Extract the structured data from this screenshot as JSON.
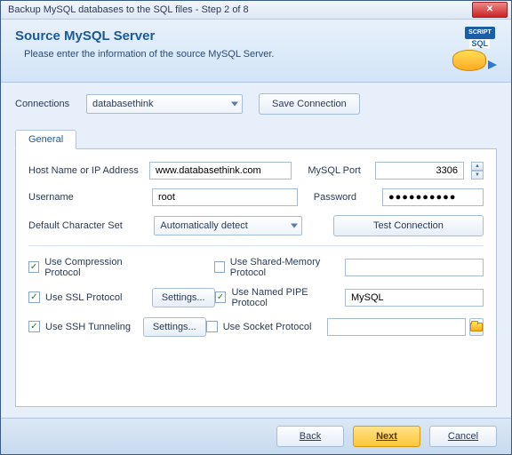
{
  "window": {
    "title": "Backup MySQL databases to the SQL files - Step 2 of 8"
  },
  "header": {
    "title": "Source MySQL Server",
    "subtitle": "Please enter the information of the source MySQL Server.",
    "script_tag": "SCRIPT",
    "sql_label": "SQL"
  },
  "connections": {
    "label": "Connections",
    "selected": "databasethink",
    "save_btn": "Save Connection"
  },
  "tab": {
    "general": "General"
  },
  "form": {
    "host_label": "Host Name or IP Address",
    "host_value": "www.databasethink.com",
    "port_label": "MySQL Port",
    "port_value": "3306",
    "user_label": "Username",
    "user_value": "root",
    "pass_label": "Password",
    "pass_value": "●●●●●●●●●●",
    "charset_label": "Default Character Set",
    "charset_value": "Automatically detect",
    "test_btn": "Test Connection",
    "compression_label": "Use Compression Protocol",
    "ssl_label": "Use SSL Protocol",
    "ssh_label": "Use SSH Tunneling",
    "settings_btn": "Settings...",
    "shared_label": "Use Shared-Memory Protocol",
    "pipe_label": "Use Named PIPE Protocol",
    "pipe_value": "MySQL",
    "socket_label": "Use Socket Protocol",
    "compression_checked": true,
    "ssl_checked": true,
    "ssh_checked": true,
    "shared_checked": false,
    "pipe_checked": true,
    "socket_checked": false
  },
  "footer": {
    "back": "Back",
    "next": "Next",
    "cancel": "Cancel"
  }
}
